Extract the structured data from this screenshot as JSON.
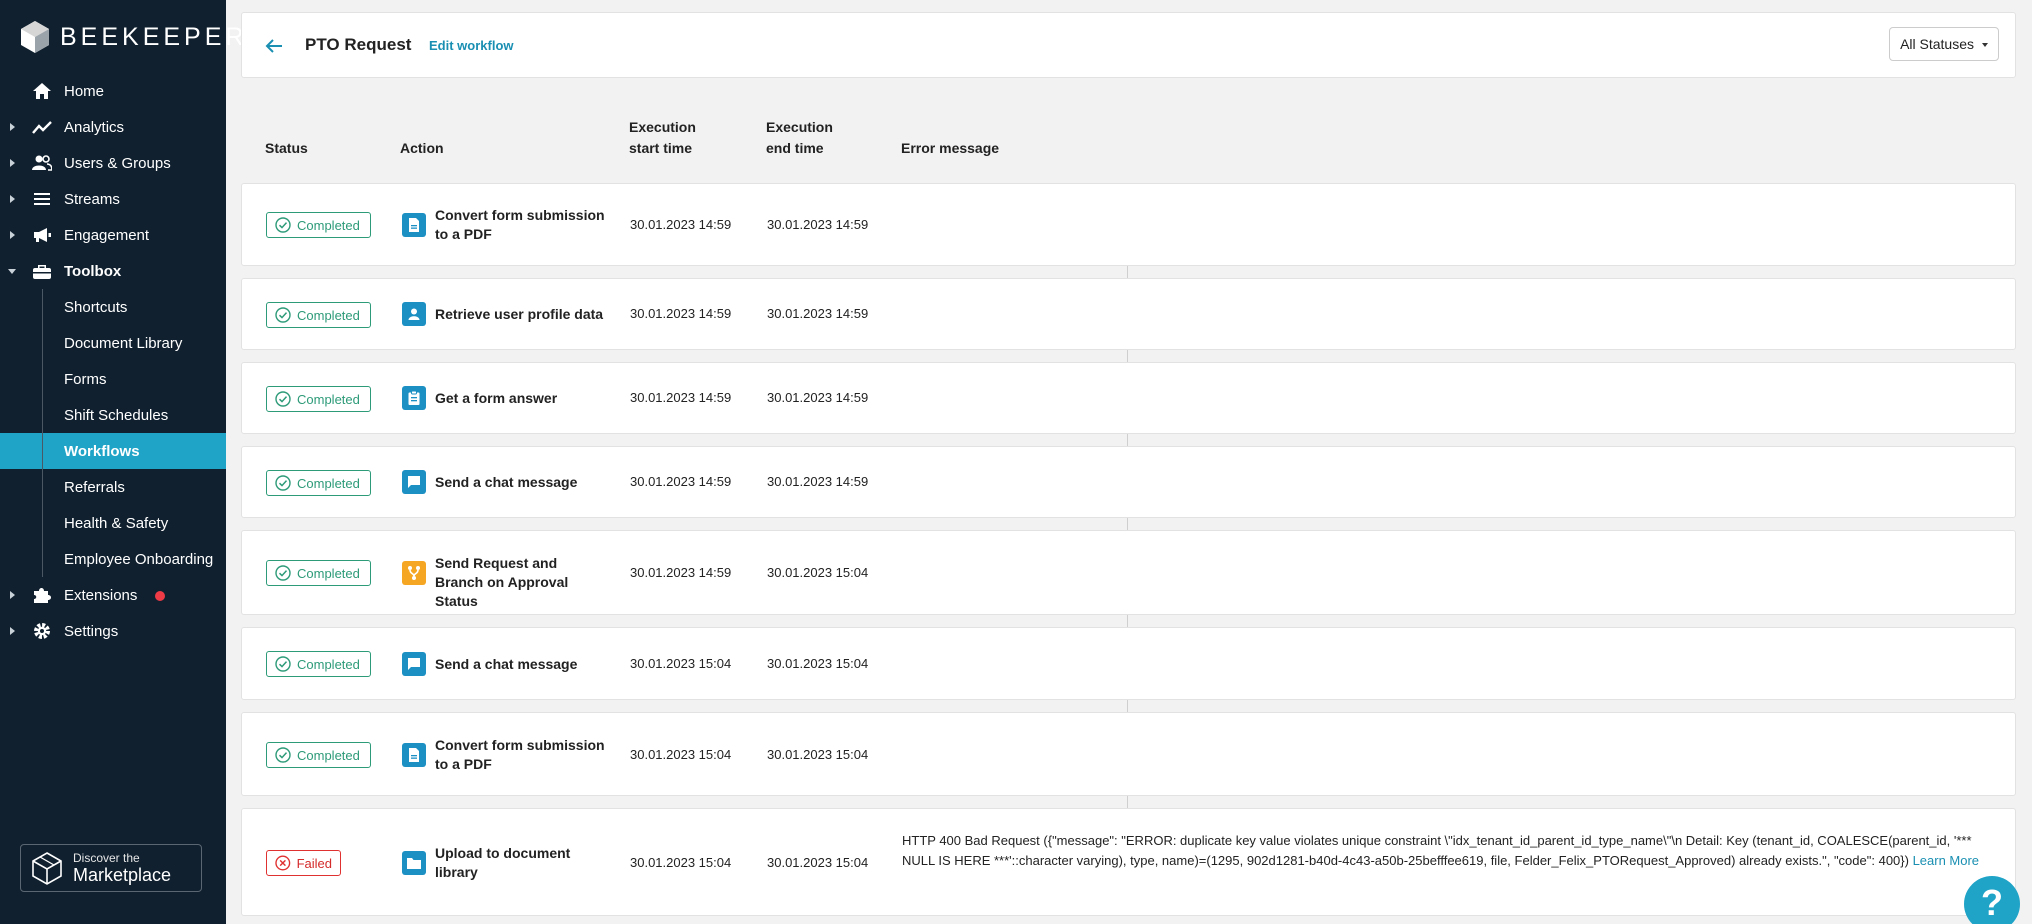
{
  "brand": {
    "name": "BEEKEEPER"
  },
  "sidebar": {
    "items": [
      {
        "label": "Home",
        "icon": "home-icon"
      },
      {
        "label": "Analytics",
        "icon": "analytics-icon"
      },
      {
        "label": "Users & Groups",
        "icon": "users-icon"
      },
      {
        "label": "Streams",
        "icon": "streams-icon"
      },
      {
        "label": "Engagement",
        "icon": "megaphone-icon"
      },
      {
        "label": "Toolbox",
        "icon": "toolbox-icon"
      },
      {
        "label": "Extensions",
        "icon": "puzzle-icon"
      },
      {
        "label": "Settings",
        "icon": "gear-icon"
      }
    ],
    "toolbox_items": [
      "Shortcuts",
      "Document Library",
      "Forms",
      "Shift Schedules",
      "Workflows",
      "Referrals",
      "Health & Safety",
      "Employee Onboarding"
    ],
    "active_item": "Workflows",
    "marketplace": {
      "small": "Discover the",
      "big": "Marketplace"
    }
  },
  "header": {
    "title": "PTO Request",
    "edit_link": "Edit workflow",
    "status_filter": "All Statuses"
  },
  "table": {
    "columns": {
      "status": "Status",
      "action": "Action",
      "start_l1": "Execution",
      "start_l2": "start time",
      "end_l1": "Execution",
      "end_l2": "end time",
      "error": "Error message"
    },
    "rows": [
      {
        "status": "Completed",
        "action": "Convert form submission to a PDF",
        "icon": "document-icon",
        "start": "30.01.2023 14:59",
        "end": "30.01.2023 14:59",
        "error": ""
      },
      {
        "status": "Completed",
        "action": "Retrieve user profile data",
        "icon": "user-profile-icon",
        "start": "30.01.2023 14:59",
        "end": "30.01.2023 14:59",
        "error": ""
      },
      {
        "status": "Completed",
        "action": "Get a form answer",
        "icon": "clipboard-icon",
        "start": "30.01.2023 14:59",
        "end": "30.01.2023 14:59",
        "error": ""
      },
      {
        "status": "Completed",
        "action": "Send a chat message",
        "icon": "chat-icon",
        "start": "30.01.2023 14:59",
        "end": "30.01.2023 14:59",
        "error": ""
      },
      {
        "status": "Completed",
        "action": "Send Request and Branch on Approval Status",
        "icon": "branch-icon",
        "start": "30.01.2023 14:59",
        "end": "30.01.2023 15:04",
        "error": ""
      },
      {
        "status": "Completed",
        "action": "Send a chat message",
        "icon": "chat-icon",
        "start": "30.01.2023 15:04",
        "end": "30.01.2023 15:04",
        "error": ""
      },
      {
        "status": "Completed",
        "action": "Convert form submission to a PDF",
        "icon": "document-icon",
        "start": "30.01.2023 15:04",
        "end": "30.01.2023 15:04",
        "error": ""
      },
      {
        "status": "Failed",
        "action": "Upload to document library",
        "icon": "folder-icon",
        "start": "30.01.2023 15:04",
        "end": "30.01.2023 15:04",
        "error": "HTTP 400 Bad Request ({\"message\": \"ERROR: duplicate key value violates unique constraint \\\"idx_tenant_id_parent_id_type_name\\\"\\n Detail: Key (tenant_id, COALESCE(parent_id, '*** NULL IS HERE ***'::character varying), type, name)=(1295, 902d1281-b40d-4c43-a50b-25befffee619, file, Felder_Felix_PTORequest_Approved) already exists.\", \"code\": 400}) ",
        "learn_more": "Learn More"
      }
    ]
  },
  "help": {
    "label": "?"
  },
  "colors": {
    "sidebar": "#10202f",
    "accent": "#1fa3c7",
    "success": "#2d9a78",
    "danger": "#e03131",
    "orange": "#f5a623"
  }
}
